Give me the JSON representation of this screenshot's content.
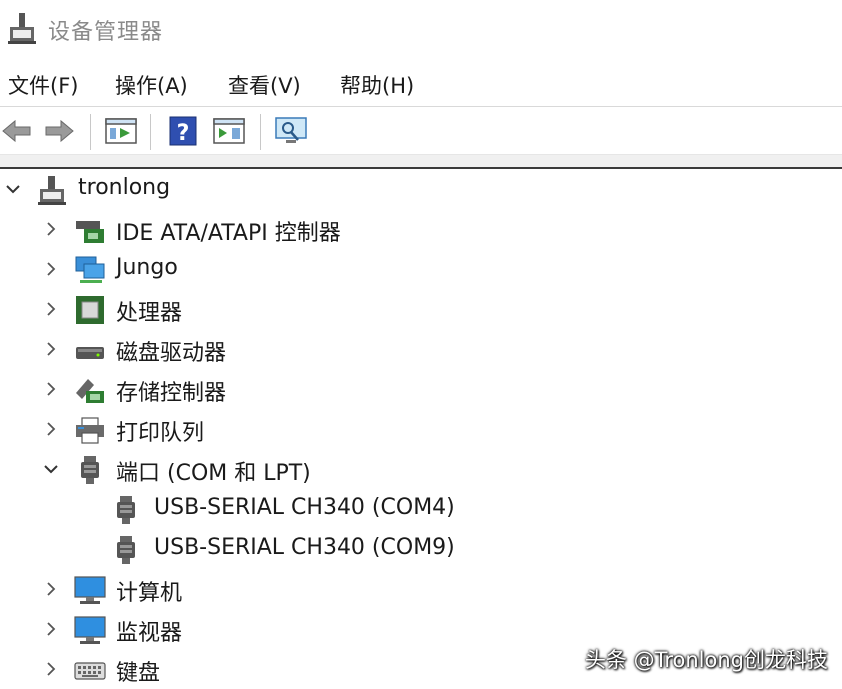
{
  "window": {
    "title": "设备管理器"
  },
  "menubar": {
    "items": [
      "文件(F)",
      "操作(A)",
      "查看(V)",
      "帮助(H)"
    ]
  },
  "toolbar": {
    "buttons": [
      "back-arrow-icon",
      "forward-arrow-icon",
      "properties-icon",
      "help-icon",
      "update-driver-icon",
      "scan-hardware-icon"
    ]
  },
  "tree": {
    "root": {
      "label": "tronlong",
      "icon": "computer-tower-icon",
      "expanded": true
    },
    "items": [
      {
        "label": "IDE ATA/ATAPI 控制器",
        "icon": "ide-controller-icon",
        "expanded": false
      },
      {
        "label": "Jungo",
        "icon": "network-monitor-icon",
        "expanded": false
      },
      {
        "label": "处理器",
        "icon": "processor-icon",
        "expanded": false
      },
      {
        "label": "磁盘驱动器",
        "icon": "disk-drive-icon",
        "expanded": false
      },
      {
        "label": "存储控制器",
        "icon": "storage-controller-icon",
        "expanded": false
      },
      {
        "label": "打印队列",
        "icon": "printer-icon",
        "expanded": false
      },
      {
        "label": "端口 (COM 和 LPT)",
        "icon": "port-icon",
        "expanded": true,
        "children": [
          {
            "label": "USB-SERIAL CH340 (COM4)",
            "icon": "port-icon"
          },
          {
            "label": "USB-SERIAL CH340 (COM9)",
            "icon": "port-icon"
          }
        ]
      },
      {
        "label": "计算机",
        "icon": "monitor-icon",
        "expanded": false
      },
      {
        "label": "监视器",
        "icon": "monitor-icon",
        "expanded": false
      },
      {
        "label": "键盘",
        "icon": "keyboard-icon",
        "expanded": false
      }
    ]
  },
  "watermark": "头条 @Tronlong创龙科技"
}
